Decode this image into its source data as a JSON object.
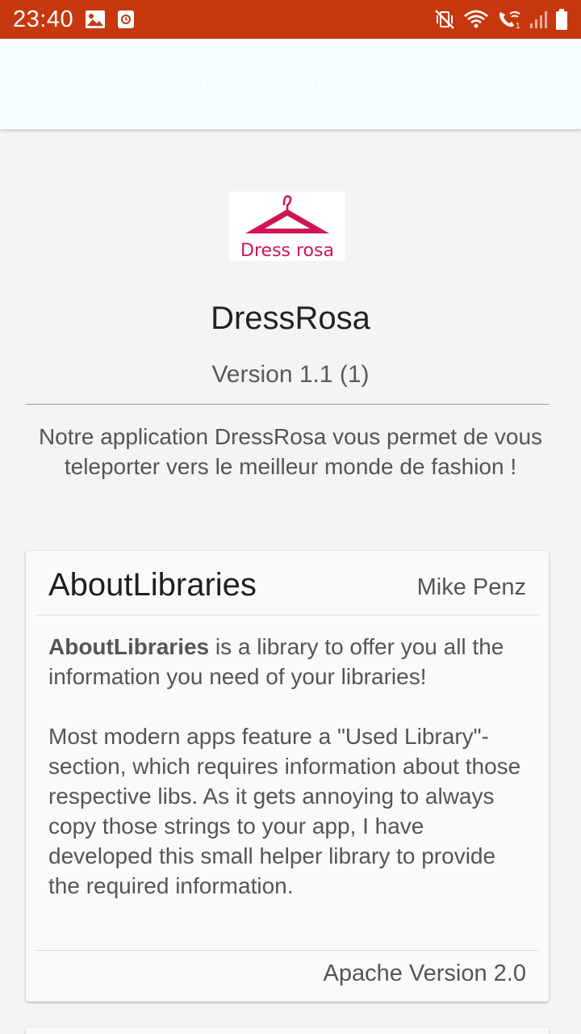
{
  "status_bar": {
    "time": "23:40",
    "bg_color": "#c7380f",
    "left_icons": [
      "image-icon",
      "clock-app-icon"
    ],
    "right_icons": [
      "mute-vibrate-icon",
      "wifi-icon",
      "wifi-call-icon",
      "signal-icon",
      "battery-icon"
    ]
  },
  "app_bar": {
    "title": "A propos de DressRosa",
    "back_icon": "arrow-back-icon"
  },
  "about": {
    "logo_text": "Dress rosa",
    "app_name": "DressRosa",
    "version": "Version 1.1 (1)",
    "description": "Notre application DressRosa vous permet de vous teleporter vers le meilleur monde de fashion !"
  },
  "library_card": {
    "name": "AboutLibraries",
    "author": "Mike Penz",
    "body_bold": "AboutLibraries",
    "body_intro_rest": " is a library to offer you all the information you need of your libraries!",
    "body_paragraph_2": "Most modern apps feature a \"Used Library\"-section, which requires information about those respective libs. As it gets annoying to always copy those strings to your app, I have developed this small helper library to provide the required information.",
    "license": "Apache Version 2.0"
  },
  "colors": {
    "brand": "#d01458",
    "accent_status": "#c7380f"
  }
}
